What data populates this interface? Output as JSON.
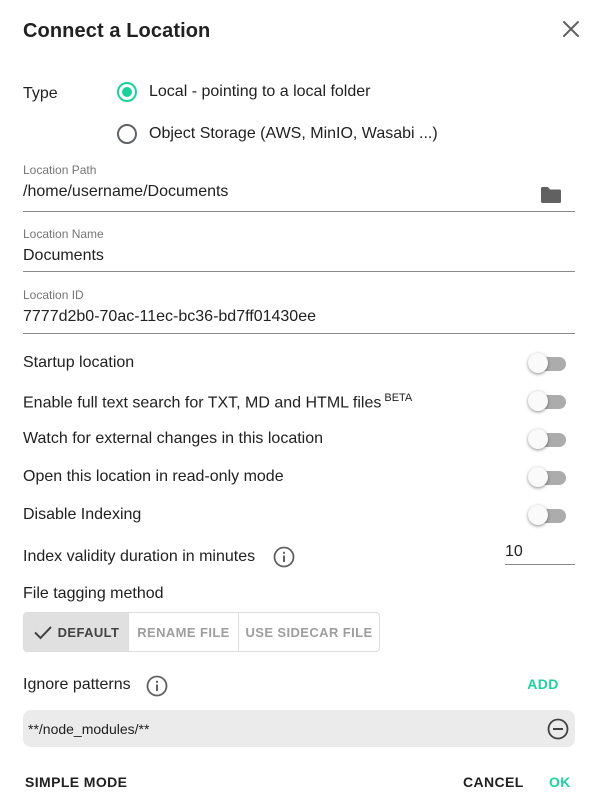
{
  "dialog": {
    "title": "Connect a Location",
    "close_icon": "close-icon"
  },
  "type": {
    "label": "Type",
    "options": [
      {
        "label": "Local - pointing to a local folder",
        "selected": true
      },
      {
        "label": "Object Storage (AWS, MinIO, Wasabi ...)",
        "selected": false
      }
    ]
  },
  "location_path": {
    "label": "Location Path",
    "value": "/home/username/Documents",
    "icon": "folder-icon"
  },
  "location_name": {
    "label": "Location Name",
    "value": "Documents"
  },
  "location_id": {
    "label": "Location ID",
    "value": "7777d2b0-70ac-11ec-bc36-bd7ff01430ee"
  },
  "switches": [
    {
      "label": "Startup location",
      "on": false
    },
    {
      "label": "Enable full text search for TXT, MD and HTML files",
      "badge": "BETA",
      "on": false
    },
    {
      "label": "Watch for external changes in this location",
      "on": false
    },
    {
      "label": "Open this location in read-only mode",
      "on": false
    },
    {
      "label": "Disable Indexing",
      "on": false
    }
  ],
  "index_validity": {
    "label": "Index validity duration in minutes",
    "value": "10",
    "icon": "info-icon"
  },
  "tagging": {
    "label": "File tagging method",
    "options": [
      "DEFAULT",
      "RENAME FILE",
      "USE SIDECAR FILE"
    ],
    "selected": "DEFAULT"
  },
  "ignore": {
    "label": "Ignore patterns",
    "add_label": "ADD",
    "patterns": [
      "**/node_modules/**"
    ]
  },
  "footer": {
    "simple_mode": "SIMPLE MODE",
    "cancel": "CANCEL",
    "ok": "OK"
  },
  "colors": {
    "accent": "#1dd19f",
    "text": "#212121",
    "muted": "#757575"
  }
}
